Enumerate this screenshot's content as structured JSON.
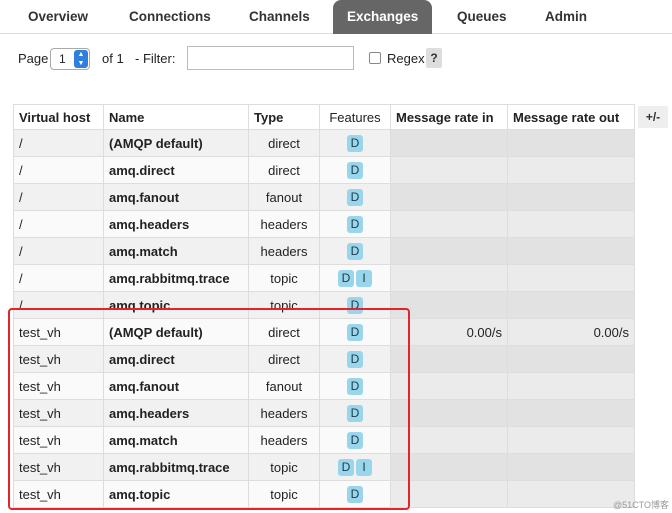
{
  "tabs": [
    {
      "label": "Overview"
    },
    {
      "label": "Connections"
    },
    {
      "label": "Channels"
    },
    {
      "label": "Exchanges",
      "active": true
    },
    {
      "label": "Queues"
    },
    {
      "label": "Admin"
    }
  ],
  "filter": {
    "page_label": "Page",
    "page_value": "1",
    "of_label": "of 1",
    "filter_label": "- Filter:",
    "filter_value": "",
    "regex_label": "Regex",
    "help_label": "?"
  },
  "table": {
    "columns": [
      "Virtual host",
      "Name",
      "Type",
      "Features",
      "Message rate in",
      "Message rate out"
    ],
    "column_toggle": "+/-",
    "rows": [
      {
        "vhost": "/",
        "name": "(AMQP default)",
        "type": "direct",
        "features": [
          "D"
        ],
        "rate_in": "",
        "rate_out": ""
      },
      {
        "vhost": "/",
        "name": "amq.direct",
        "type": "direct",
        "features": [
          "D"
        ],
        "rate_in": "",
        "rate_out": ""
      },
      {
        "vhost": "/",
        "name": "amq.fanout",
        "type": "fanout",
        "features": [
          "D"
        ],
        "rate_in": "",
        "rate_out": ""
      },
      {
        "vhost": "/",
        "name": "amq.headers",
        "type": "headers",
        "features": [
          "D"
        ],
        "rate_in": "",
        "rate_out": ""
      },
      {
        "vhost": "/",
        "name": "amq.match",
        "type": "headers",
        "features": [
          "D"
        ],
        "rate_in": "",
        "rate_out": ""
      },
      {
        "vhost": "/",
        "name": "amq.rabbitmq.trace",
        "type": "topic",
        "features": [
          "D",
          "I"
        ],
        "rate_in": "",
        "rate_out": ""
      },
      {
        "vhost": "/",
        "name": "amq.topic",
        "type": "topic",
        "features": [
          "D"
        ],
        "rate_in": "",
        "rate_out": ""
      },
      {
        "vhost": "test_vh",
        "name": "(AMQP default)",
        "type": "direct",
        "features": [
          "D"
        ],
        "rate_in": "0.00/s",
        "rate_out": "0.00/s"
      },
      {
        "vhost": "test_vh",
        "name": "amq.direct",
        "type": "direct",
        "features": [
          "D"
        ],
        "rate_in": "",
        "rate_out": ""
      },
      {
        "vhost": "test_vh",
        "name": "amq.fanout",
        "type": "fanout",
        "features": [
          "D"
        ],
        "rate_in": "",
        "rate_out": ""
      },
      {
        "vhost": "test_vh",
        "name": "amq.headers",
        "type": "headers",
        "features": [
          "D"
        ],
        "rate_in": "",
        "rate_out": ""
      },
      {
        "vhost": "test_vh",
        "name": "amq.match",
        "type": "headers",
        "features": [
          "D"
        ],
        "rate_in": "",
        "rate_out": ""
      },
      {
        "vhost": "test_vh",
        "name": "amq.rabbitmq.trace",
        "type": "topic",
        "features": [
          "D",
          "I"
        ],
        "rate_in": "",
        "rate_out": ""
      },
      {
        "vhost": "test_vh",
        "name": "amq.topic",
        "type": "topic",
        "features": [
          "D"
        ],
        "rate_in": "",
        "rate_out": ""
      }
    ]
  },
  "watermark": "@51CTO博客",
  "colors": {
    "active_tab": "#666666",
    "feature_badge": "#99d6ec",
    "highlight": "#e0262b"
  }
}
